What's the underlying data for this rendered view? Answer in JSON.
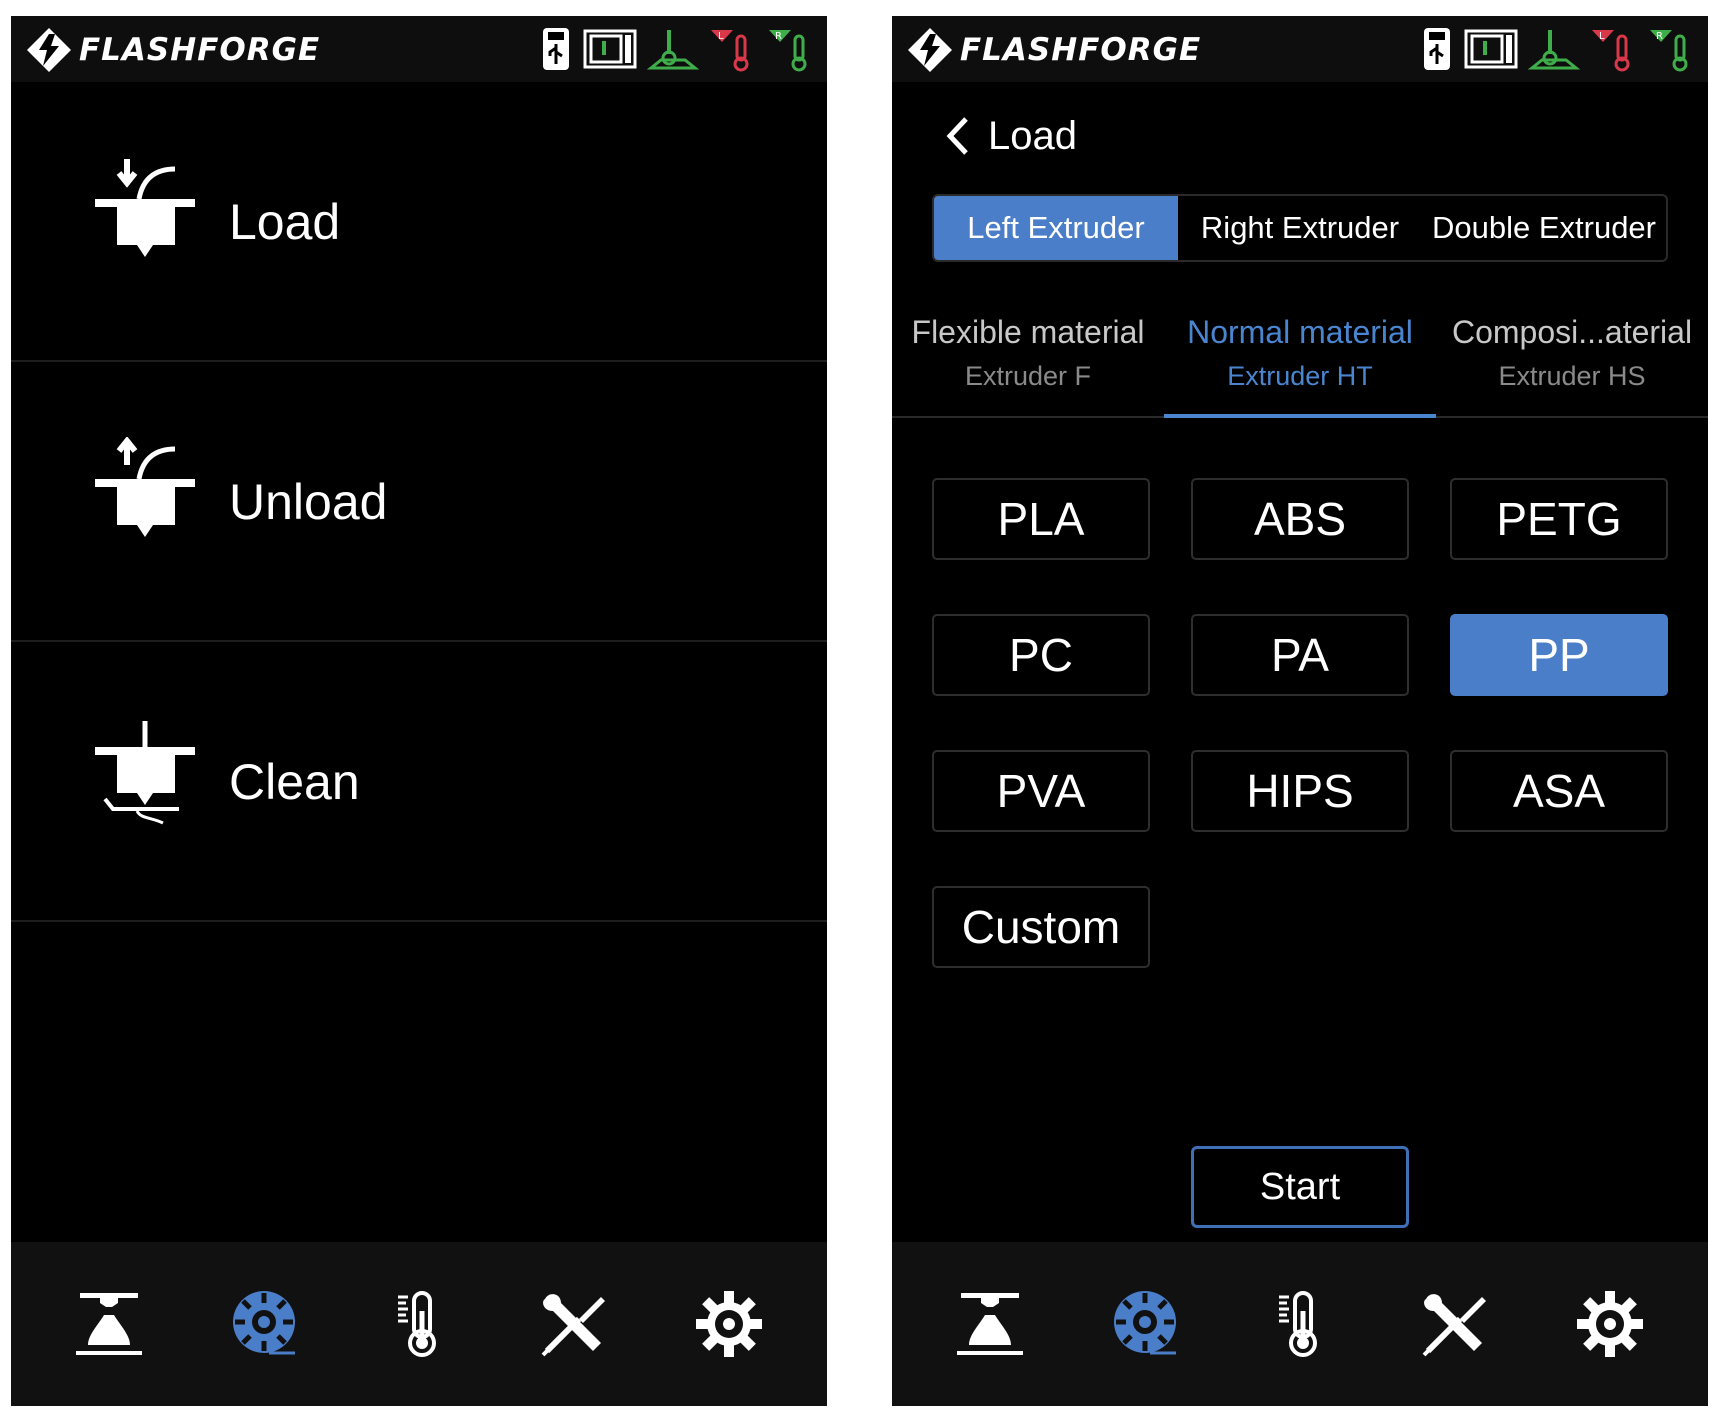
{
  "brand": {
    "name": "FLASHFORGE"
  },
  "status_icons": [
    "usb-icon",
    "camera-icon",
    "platform-temp-icon",
    "left-extruder-temp-icon",
    "right-extruder-temp-icon"
  ],
  "status_colors": {
    "green": "#3fae4a",
    "red": "#d9384a"
  },
  "accent_color": "#4a7ec8",
  "left_screen": {
    "menu": [
      {
        "id": "load",
        "label": "Load",
        "icon": "load-filament-icon"
      },
      {
        "id": "unload",
        "label": "Unload",
        "icon": "unload-filament-icon"
      },
      {
        "id": "clean",
        "label": "Clean",
        "icon": "clean-nozzle-icon"
      }
    ]
  },
  "right_screen": {
    "back_title": "Load",
    "extruder_tabs": [
      {
        "label": "Left Extruder",
        "active": true
      },
      {
        "label": "Right Extruder",
        "active": false
      },
      {
        "label": "Double Extruder",
        "active": false
      }
    ],
    "material_tabs": [
      {
        "title": "Flexible material",
        "subtitle": "Extruder F",
        "active": false
      },
      {
        "title": "Normal material",
        "subtitle": "Extruder HT",
        "active": true
      },
      {
        "title": "Composi...aterial",
        "subtitle": "Extruder HS",
        "active": false
      }
    ],
    "materials": [
      {
        "label": "PLA",
        "selected": false
      },
      {
        "label": "ABS",
        "selected": false
      },
      {
        "label": "PETG",
        "selected": false
      },
      {
        "label": "PC",
        "selected": false
      },
      {
        "label": "PA",
        "selected": false
      },
      {
        "label": "PP",
        "selected": true
      },
      {
        "label": "PVA",
        "selected": false
      },
      {
        "label": "HIPS",
        "selected": false
      },
      {
        "label": "ASA",
        "selected": false
      },
      {
        "label": "Custom",
        "selected": false
      }
    ],
    "start_label": "Start"
  },
  "bottom_nav": [
    {
      "id": "print",
      "icon": "printer-icon",
      "active": false
    },
    {
      "id": "filament",
      "icon": "filament-spool-icon",
      "active": true
    },
    {
      "id": "temperature",
      "icon": "thermometer-icon",
      "active": false
    },
    {
      "id": "tools",
      "icon": "tools-icon",
      "active": false
    },
    {
      "id": "settings",
      "icon": "gear-icon",
      "active": false
    }
  ]
}
